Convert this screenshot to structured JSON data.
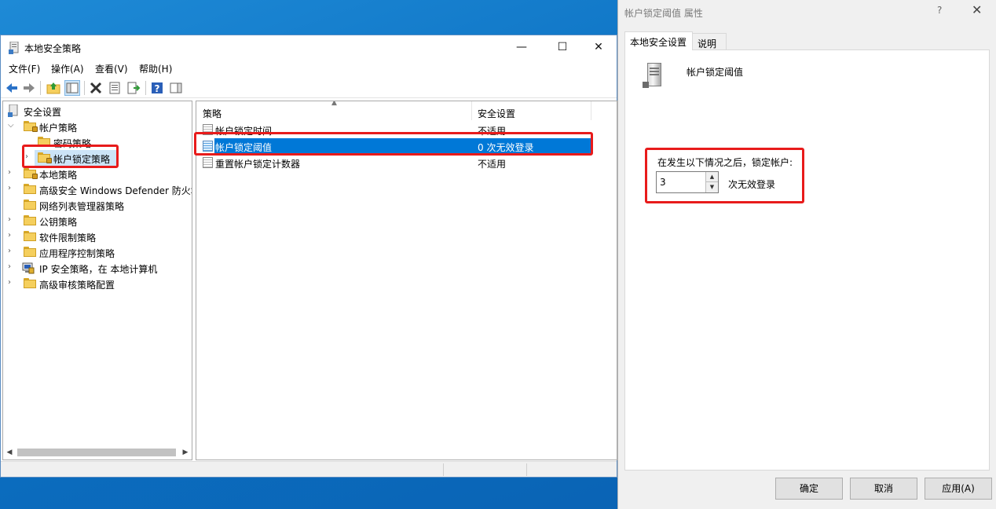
{
  "main_window": {
    "title": "本地安全策略",
    "minimize_glyph": "—",
    "maximize_glyph": "☐",
    "close_glyph": "✕",
    "menu": [
      "文件(F)",
      "操作(A)",
      "查看(V)",
      "帮助(H)"
    ]
  },
  "toolbar_icons": [
    "back-icon",
    "forward-icon",
    "up-folder-icon",
    "show-hide-tree-icon",
    "delete-icon",
    "properties-icon",
    "export-list-icon",
    "help-icon",
    "show-action-pane-icon"
  ],
  "tree": {
    "root": "安全设置",
    "account_policies": "帐户策略",
    "password_policy": "密码策略",
    "lockout_policy": "帐户锁定策略",
    "local_policies": "本地策略",
    "defender_firewall": "高级安全 Windows Defender 防火墙",
    "network_list": "网络列表管理器策略",
    "public_key": "公钥策略",
    "software_restriction": "软件限制策略",
    "app_control": "应用程序控制策略",
    "ip_security": "IP 安全策略，在 本地计算机",
    "advanced_audit": "高级审核策略配置"
  },
  "list": {
    "col_policy": "策略",
    "col_setting": "安全设置",
    "rows": [
      {
        "policy": "帐户锁定时间",
        "setting": "不适用"
      },
      {
        "policy": "帐户锁定阈值",
        "setting": "0 次无效登录"
      },
      {
        "policy": "重置帐户锁定计数器",
        "setting": "不适用"
      }
    ]
  },
  "dialog": {
    "title": "帐户锁定阈值 属性",
    "help_glyph": "?",
    "close_glyph": "✕",
    "tab_local": "本地安全设置",
    "tab_explain": "说明",
    "policy_name": "帐户锁定阈值",
    "after_label": "在发生以下情况之后，锁定帐户:",
    "threshold_value": "3",
    "unit_label": "次无效登录",
    "ok": "确定",
    "cancel": "取消",
    "apply": "应用(A)"
  },
  "colors": {
    "highlight": "#e81b1b",
    "selection": "#0078d7"
  }
}
